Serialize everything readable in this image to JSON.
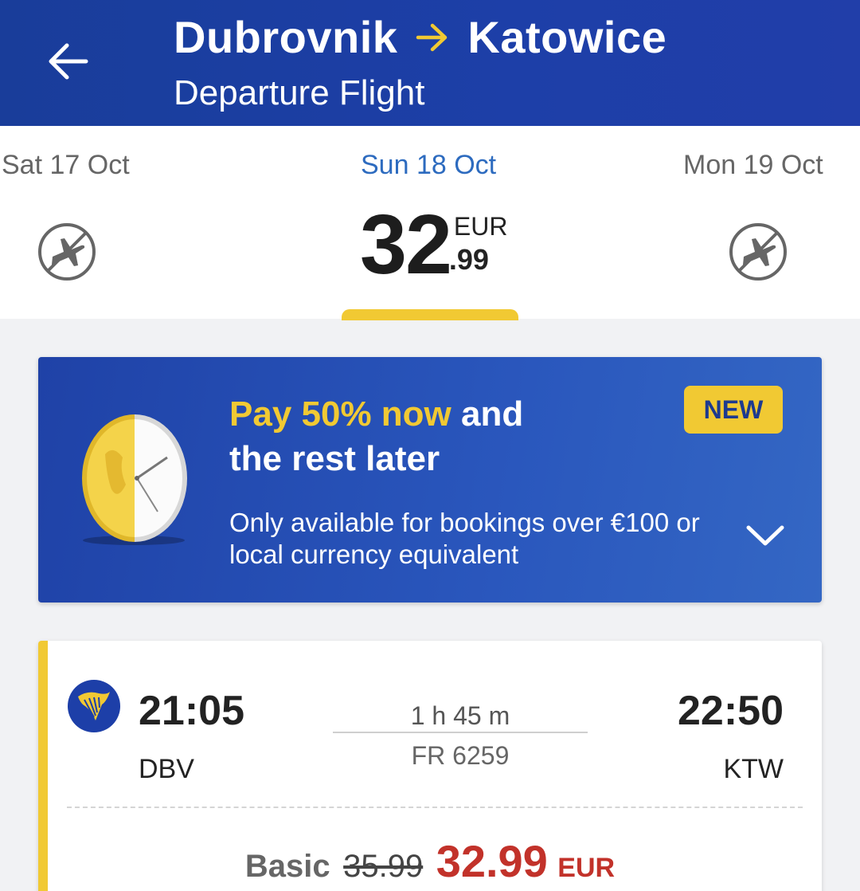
{
  "header": {
    "origin": "Dubrovnik",
    "destination": "Katowice",
    "subtitle": "Departure Flight"
  },
  "dates": [
    {
      "label": "Sat 17 Oct",
      "available": false
    },
    {
      "label": "Sun 18 Oct",
      "available": true,
      "selected": true,
      "price_int": "32",
      "price_dec": ".99",
      "currency": "EUR"
    },
    {
      "label": "Mon 19 Oct",
      "available": false
    }
  ],
  "promo": {
    "title_highlight": "Pay 50% now",
    "title_rest_1": " and",
    "title_rest_2": "the rest later",
    "badge": "NEW",
    "description": "Only available for bookings over €100 or local currency equivalent"
  },
  "flight": {
    "departure_time": "21:05",
    "departure_code": "DBV",
    "arrival_time": "22:50",
    "arrival_code": "KTW",
    "duration": "1 h 45 m",
    "flight_number": "FR 6259",
    "fare_label": "Basic",
    "old_price": "35.99",
    "new_price": "32.99",
    "currency": "EUR"
  },
  "colors": {
    "header_blue": "#1d3fa8",
    "accent_yellow": "#f1c933",
    "selected_date_blue": "#2d6bbf",
    "price_red": "#c2322a"
  }
}
